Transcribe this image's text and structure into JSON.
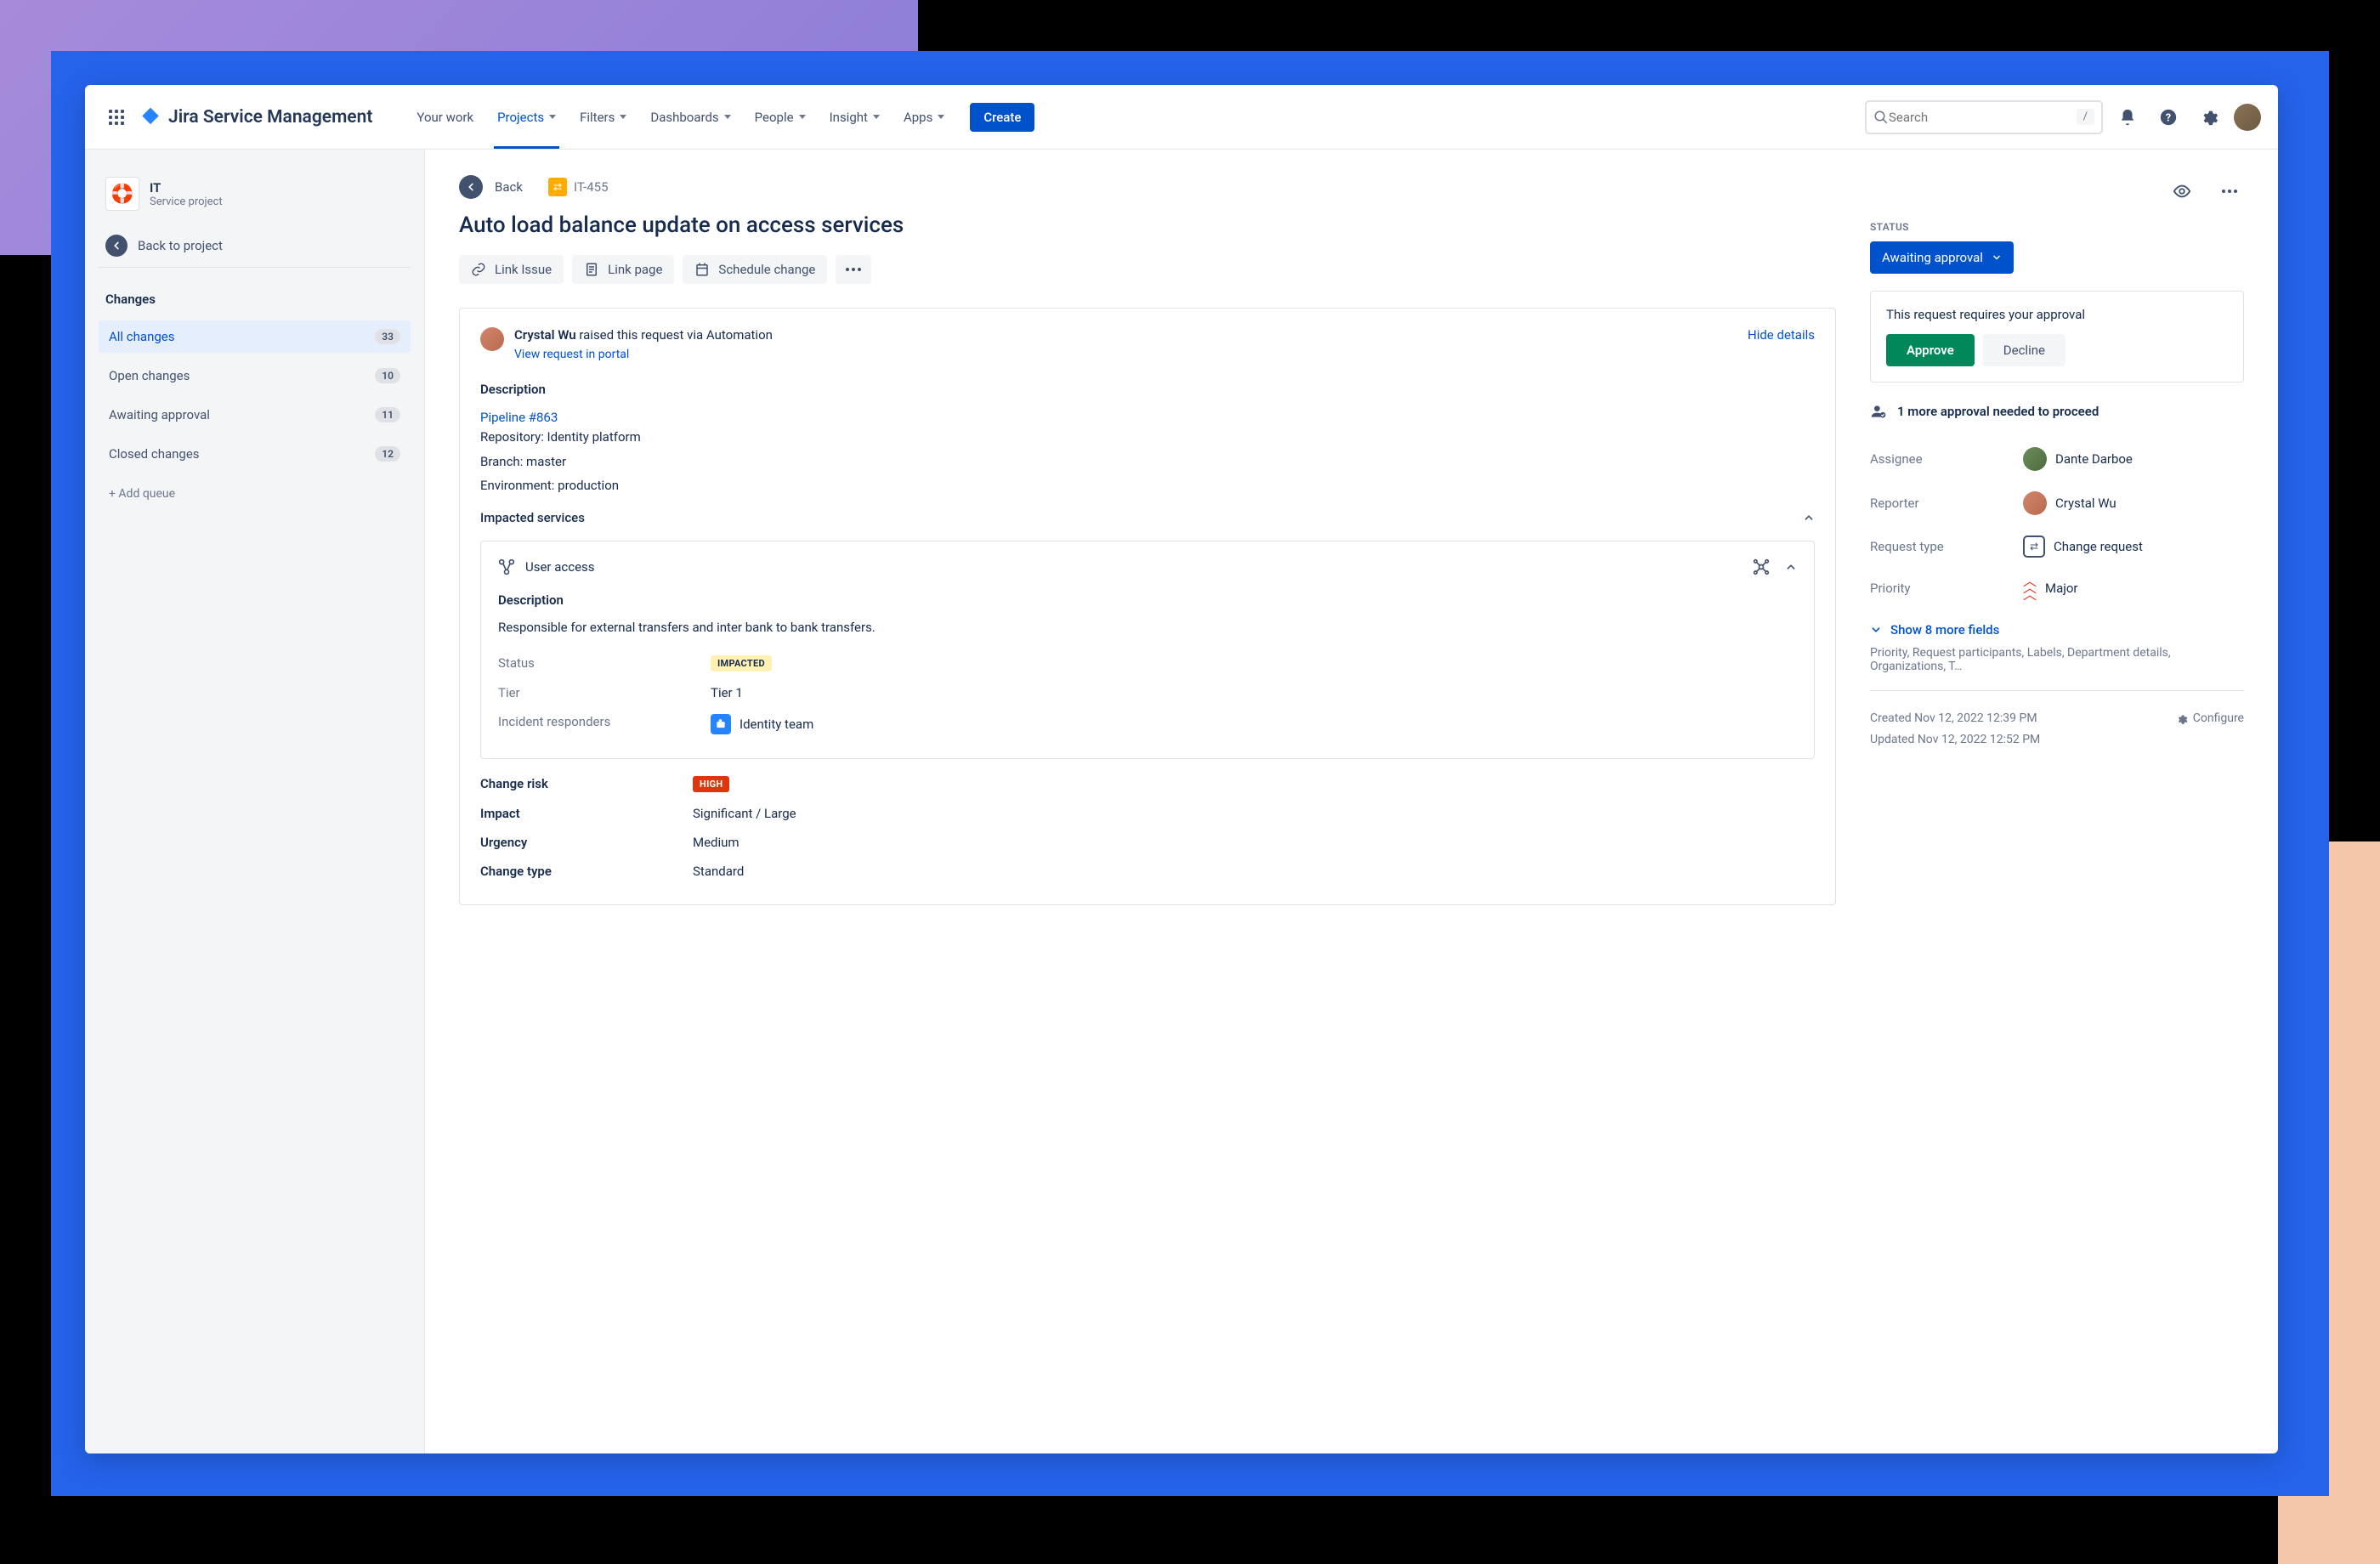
{
  "brand": "Jira Service Management",
  "nav": {
    "your_work": "Your work",
    "projects": "Projects",
    "filters": "Filters",
    "dashboards": "Dashboards",
    "people": "People",
    "insight": "Insight",
    "apps": "Apps",
    "create": "Create",
    "search_placeholder": "Search",
    "search_kbd": "/"
  },
  "sidebar": {
    "project_name": "IT",
    "project_sub": "Service project",
    "back": "Back to project",
    "section": "Changes",
    "items": [
      {
        "label": "All changes",
        "count": "33"
      },
      {
        "label": "Open changes",
        "count": "10"
      },
      {
        "label": "Awaiting approval",
        "count": "11"
      },
      {
        "label": "Closed changes",
        "count": "12"
      }
    ],
    "add": "+ Add queue"
  },
  "issue": {
    "back": "Back",
    "key": "IT-455",
    "title": "Auto load balance update on access services",
    "actions": {
      "link_issue": "Link Issue",
      "link_page": "Link page",
      "schedule": "Schedule change"
    },
    "requester": {
      "name": "Crystal Wu",
      "suffix": " raised this request via Automation",
      "view": "View request in portal",
      "hide": "Hide details"
    },
    "description": {
      "heading": "Description",
      "pipeline": "Pipeline #863",
      "repo": "Repository: Identity platform",
      "branch": "Branch: master",
      "env": "Environment: production"
    },
    "impacted": {
      "heading": "Impacted services",
      "service": "User access",
      "desc_h": "Description",
      "desc": "Responsible for external transfers and inter bank to bank transfers.",
      "status_k": "Status",
      "status_v": "IMPACTED",
      "tier_k": "Tier",
      "tier_v": "Tier 1",
      "resp_k": "Incident responders",
      "resp_v": "Identity team"
    },
    "risk_k": "Change risk",
    "risk_v": "HIGH",
    "impact_k": "Impact",
    "impact_v": "Significant / Large",
    "urgency_k": "Urgency",
    "urgency_v": "Medium",
    "ctype_k": "Change type",
    "ctype_v": "Standard"
  },
  "side": {
    "status_label": "STATUS",
    "status": "Awaiting approval",
    "approval_msg": "This request requires your approval",
    "approve": "Approve",
    "decline": "Decline",
    "needed": "1 more approval needed to proceed",
    "assignee_k": "Assignee",
    "assignee_v": "Dante Darboe",
    "reporter_k": "Reporter",
    "reporter_v": "Crystal Wu",
    "reqtype_k": "Request type",
    "reqtype_v": "Change request",
    "priority_k": "Priority",
    "priority_v": "Major",
    "more": "Show 8 more fields",
    "more_desc": "Priority, Request participants, Labels, Department details, Organizations, T…",
    "created": "Created Nov 12, 2022 12:39 PM",
    "updated": "Updated Nov 12, 2022 12:52 PM",
    "configure": "Configure"
  }
}
